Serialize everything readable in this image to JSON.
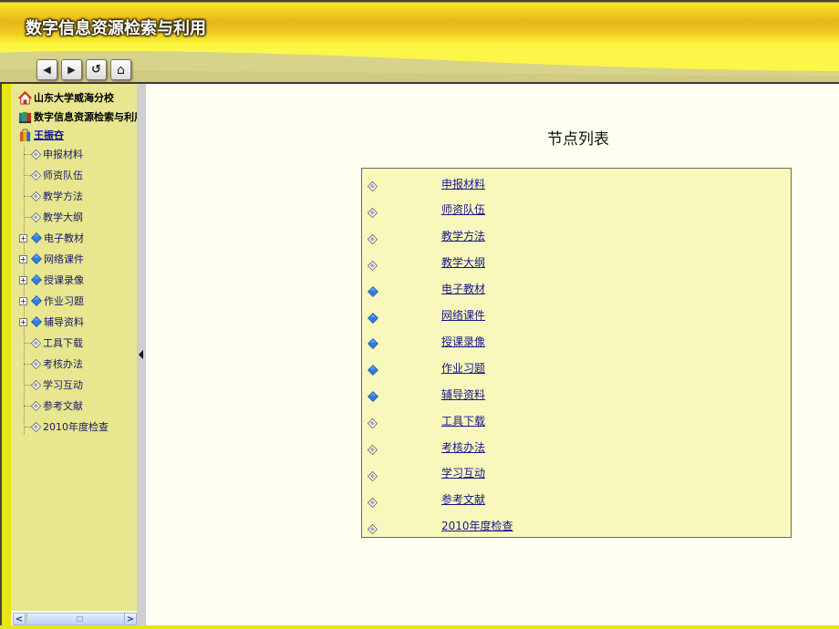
{
  "header": {
    "title": "数字信息资源检索与利用",
    "nav": [
      {
        "name": "back-button",
        "icon": "left-arrow-icon",
        "glyph": "◀"
      },
      {
        "name": "forward-button",
        "icon": "right-arrow-icon",
        "glyph": "▶"
      },
      {
        "name": "refresh-button",
        "icon": "refresh-icon",
        "glyph": "↺"
      },
      {
        "name": "home-button",
        "icon": "home-icon",
        "glyph": "⌂"
      }
    ]
  },
  "sidebar": {
    "roots": [
      {
        "label": "山东大学威海分校",
        "icon": "house-icon"
      },
      {
        "label": "数字信息资源检索与利用",
        "icon": "books-icon"
      },
      {
        "label": "王振夻",
        "icon": "folder-books-icon",
        "color": "#1010a0"
      }
    ],
    "items": [
      {
        "label": "申报材料",
        "type": "doc",
        "expandable": false
      },
      {
        "label": "师资队伍",
        "type": "doc",
        "expandable": false
      },
      {
        "label": "教学方法",
        "type": "doc",
        "expandable": false
      },
      {
        "label": "教学大纲",
        "type": "doc",
        "expandable": false
      },
      {
        "label": "电子教材",
        "type": "folder",
        "expandable": true
      },
      {
        "label": "网络课件",
        "type": "folder",
        "expandable": true
      },
      {
        "label": "授课录像",
        "type": "folder",
        "expandable": true
      },
      {
        "label": "作业习题",
        "type": "folder",
        "expandable": true
      },
      {
        "label": "辅导资料",
        "type": "folder",
        "expandable": true
      },
      {
        "label": "工具下载",
        "type": "doc",
        "expandable": false
      },
      {
        "label": "考核办法",
        "type": "doc",
        "expandable": false
      },
      {
        "label": "学习互动",
        "type": "doc",
        "expandable": false
      },
      {
        "label": "参考文献",
        "type": "doc",
        "expandable": false
      },
      {
        "label": "2010年度检查",
        "type": "doc",
        "expandable": false
      }
    ],
    "expander_glyph": "+",
    "scroll_left_glyph": "<",
    "scroll_right_glyph": ">"
  },
  "main": {
    "title": "节点列表",
    "nodes": [
      {
        "label": "申报材料",
        "type": "doc"
      },
      {
        "label": "师资队伍",
        "type": "doc"
      },
      {
        "label": "教学方法",
        "type": "doc"
      },
      {
        "label": "教学大纲",
        "type": "doc"
      },
      {
        "label": "电子教材",
        "type": "folder"
      },
      {
        "label": "网络课件",
        "type": "folder"
      },
      {
        "label": "授课录像",
        "type": "folder"
      },
      {
        "label": "作业习题",
        "type": "folder"
      },
      {
        "label": "辅导资料",
        "type": "folder"
      },
      {
        "label": "工具下载",
        "type": "doc"
      },
      {
        "label": "考核办法",
        "type": "doc"
      },
      {
        "label": "学习互动",
        "type": "doc"
      },
      {
        "label": "参考文献",
        "type": "doc"
      },
      {
        "label": "2010年度检查",
        "type": "doc"
      }
    ]
  },
  "colors": {
    "header_yellow": "#f2d01e",
    "sidebar_bg": "#e8e68e",
    "content_bg": "#fffff2",
    "table_bg": "#f8f8bc",
    "link": "#16168a",
    "folder_blue": "#2f7fe0"
  }
}
